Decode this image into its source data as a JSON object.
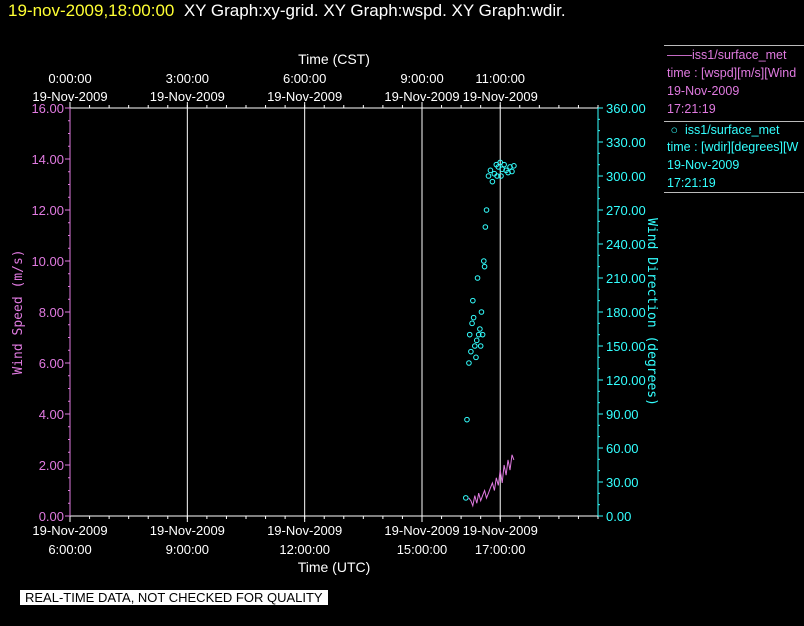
{
  "header": {
    "timestamp": "19-nov-2009,18:00:00",
    "graphs": "XY Graph:xy-grid.  XY Graph:wspd.  XY Graph:wdir."
  },
  "legend": {
    "wspd": {
      "series": "iss1/surface_met",
      "var": "time : [wspd][m/s][Wind",
      "date": "19-Nov-2009",
      "time": "17:21:19"
    },
    "wdir": {
      "series": "iss1/surface_met",
      "var": "time : [wdir][degrees][W",
      "date": "19-Nov-2009",
      "time": "17:21:19"
    }
  },
  "disclaimer": "REAL-TIME DATA, NOT CHECKED FOR QUALITY",
  "chart_data": {
    "type": "line",
    "colors": {
      "wspd": "#e07ae0",
      "wdir": "#33ffff",
      "grid": "#ffffff"
    },
    "top_axis": {
      "label": "Time (CST)",
      "ticks": [
        {
          "t": "0:00:00",
          "d": "19-Nov-2009",
          "h": 6
        },
        {
          "t": "3:00:00",
          "d": "19-Nov-2009",
          "h": 9
        },
        {
          "t": "6:00:00",
          "d": "19-Nov-2009",
          "h": 12
        },
        {
          "t": "9:00:00",
          "d": "19-Nov-2009",
          "h": 15
        },
        {
          "t": "11:00:00",
          "d": "19-Nov-2009",
          "h": 17
        }
      ]
    },
    "bottom_axis": {
      "label": "Time (UTC)",
      "ticks": [
        {
          "d": "19-Nov-2009",
          "t": "6:00:00",
          "h": 6
        },
        {
          "d": "19-Nov-2009",
          "t": "9:00:00",
          "h": 9
        },
        {
          "d": "19-Nov-2009",
          "t": "12:00:00",
          "h": 12
        },
        {
          "d": "19-Nov-2009",
          "t": "15:00:00",
          "h": 15
        },
        {
          "d": "19-Nov-2009",
          "t": "17:00:00",
          "h": 17
        }
      ],
      "range": [
        6,
        19.5
      ]
    },
    "left_axis": {
      "label": "Wind Speed (m/s)",
      "ylim": [
        0,
        16
      ],
      "ticks": [
        "0.00",
        "2.00",
        "4.00",
        "6.00",
        "8.00",
        "10.00",
        "12.00",
        "14.00",
        "16.00"
      ]
    },
    "right_axis": {
      "label": "Wind Direction (degrees)",
      "ylim": [
        0,
        360
      ],
      "ticks": [
        "0.00",
        "30.00",
        "60.00",
        "90.00",
        "120.00",
        "150.00",
        "180.00",
        "210.00",
        "240.00",
        "270.00",
        "300.00",
        "330.00",
        "360.00"
      ]
    },
    "series": [
      {
        "name": "iss1/surface_met wspd",
        "axis": "left",
        "style": "line",
        "x": [
          16.2,
          16.25,
          16.3,
          16.35,
          16.4,
          16.45,
          16.5,
          16.55,
          16.6,
          16.65,
          16.7,
          16.75,
          16.8,
          16.85,
          16.9,
          16.95,
          17.0,
          17.05,
          17.1,
          17.15,
          17.2,
          17.25,
          17.3,
          17.35
        ],
        "y": [
          0.7,
          0.6,
          0.4,
          0.8,
          0.5,
          0.9,
          0.6,
          0.8,
          1.0,
          0.7,
          0.9,
          1.1,
          1.3,
          1.0,
          1.5,
          1.2,
          1.8,
          1.3,
          2.0,
          1.6,
          2.2,
          1.8,
          2.4,
          2.2
        ]
      },
      {
        "name": "iss1/surface_met wdir",
        "axis": "right",
        "style": "circle",
        "x": [
          16.12,
          16.15,
          16.2,
          16.22,
          16.25,
          16.28,
          16.3,
          16.32,
          16.35,
          16.38,
          16.4,
          16.42,
          16.45,
          16.48,
          16.5,
          16.52,
          16.55,
          16.58,
          16.6,
          16.62,
          16.65,
          16.7,
          16.75,
          16.8,
          16.85,
          16.9,
          16.92,
          16.95,
          17.0,
          17.02,
          17.05,
          17.1,
          17.15,
          17.2,
          17.25,
          17.3,
          17.35
        ],
        "y": [
          16,
          85,
          135,
          160,
          145,
          170,
          190,
          175,
          150,
          140,
          155,
          210,
          160,
          165,
          150,
          180,
          160,
          225,
          220,
          255,
          270,
          300,
          305,
          295,
          302,
          310,
          300,
          308,
          312,
          300,
          306,
          310,
          305,
          303,
          308,
          304,
          309
        ]
      }
    ]
  }
}
